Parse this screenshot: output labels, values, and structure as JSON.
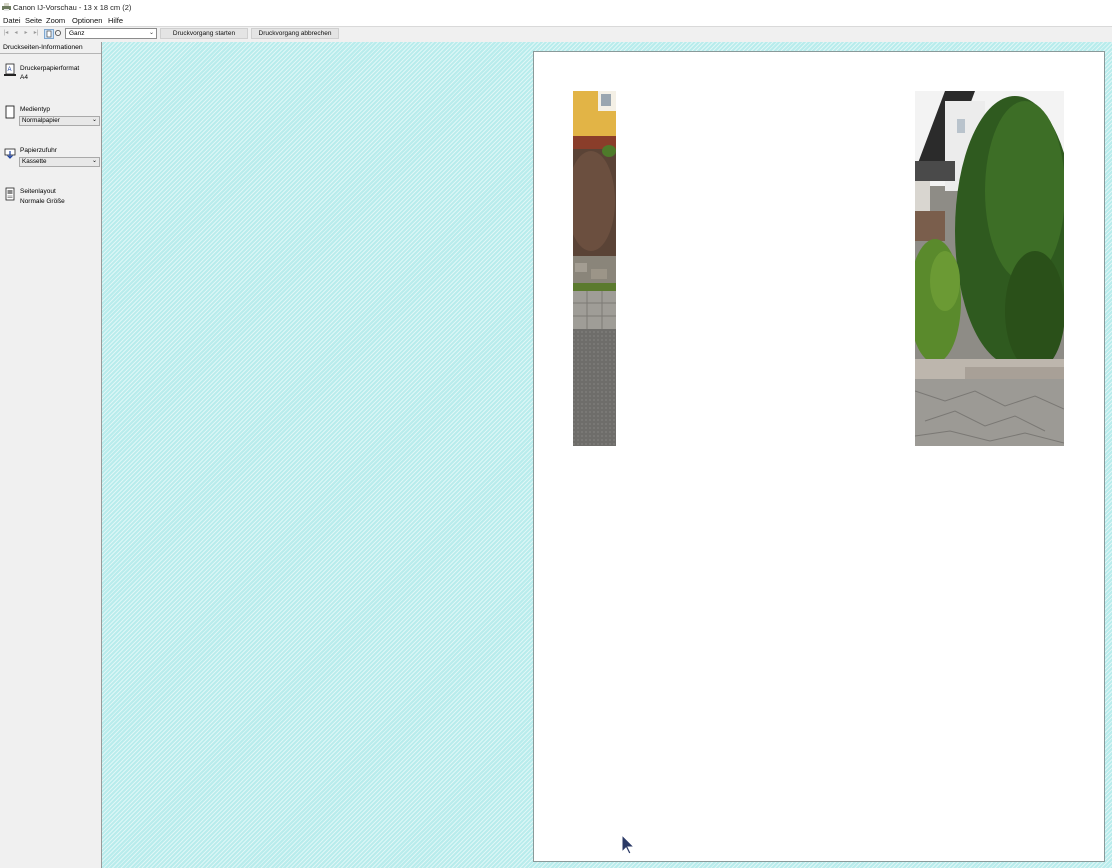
{
  "window": {
    "title": "Canon IJ-Vorschau - 13 x 18 cm (2)"
  },
  "menu": [
    "Datei",
    "Seite",
    "Zoom",
    "Optionen",
    "Hilfe"
  ],
  "toolbar": {
    "zoom_value": "Ganz",
    "start_label": "Druckvorgang starten",
    "cancel_label": "Druckvorgang abbrechen"
  },
  "sidebar": {
    "header": "Druckseiten-Informationen",
    "items": [
      {
        "label": "Druckerpapierformat",
        "value": "A4",
        "icon": "paper-size-icon"
      },
      {
        "label": "Medientyp",
        "value": "Normalpapier",
        "icon": "media-type-icon",
        "control": "select"
      },
      {
        "label": "Papierzufuhr",
        "value": "Kassette",
        "icon": "paper-source-icon",
        "control": "select"
      },
      {
        "label": "Seitenlayout",
        "value": "Normale Größe",
        "icon": "page-layout-icon"
      }
    ]
  },
  "colors": {
    "preview_background": "#b8ecec",
    "paper": "#ffffff"
  }
}
